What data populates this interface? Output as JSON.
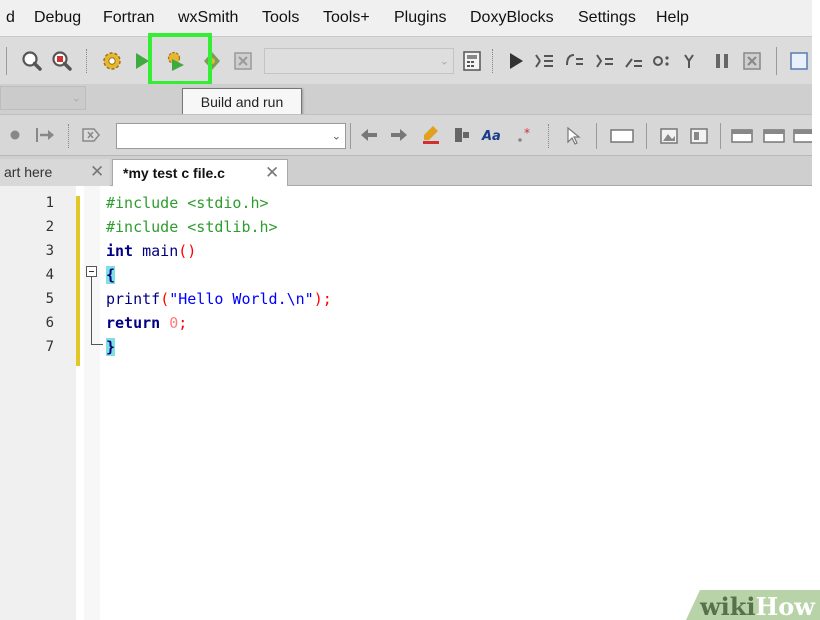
{
  "menubar": {
    "items": [
      "d",
      "Debug",
      "Fortran",
      "wxSmith",
      "Tools",
      "Tools+",
      "Plugins",
      "DoxyBlocks",
      "Settings",
      "Help"
    ]
  },
  "toolbar": {
    "highlight_color": "#33ee33",
    "icons": [
      "search-icon",
      "search-replace-icon",
      "build-gear-icon",
      "run-arrow-icon",
      "build-and-run-icon",
      "rebuild-icon",
      "abort-icon",
      "build-target-dropdown",
      "calculator-icon",
      "debug-run-icon",
      "run-to-cursor-icon",
      "next-line-icon",
      "step-into-icon",
      "step-out-icon",
      "next-instruction-icon",
      "pause-icon",
      "stop-icon"
    ]
  },
  "tooltip": {
    "text": "Build and run"
  },
  "tabs": [
    {
      "label": "art here",
      "active": false
    },
    {
      "label": "*my test c file.c",
      "active": true
    }
  ],
  "editor": {
    "line_numbers": [
      "1",
      "2",
      "3",
      "4",
      "5",
      "6",
      "7"
    ],
    "lines": [
      "#include <stdio.h>",
      "#include <stdlib.h>",
      "int main()",
      "{",
      "printf(\"Hello World.\\n\");",
      "return 0;",
      "}"
    ],
    "syntax_colors": {
      "preprocessor": "#2e9c2e",
      "keyword": "#000080",
      "string": "#0000ff",
      "number": "#ff7b7b",
      "brace_highlight": "#7fe0e0"
    }
  },
  "watermark": {
    "part1": "wiki",
    "part2": "How"
  }
}
